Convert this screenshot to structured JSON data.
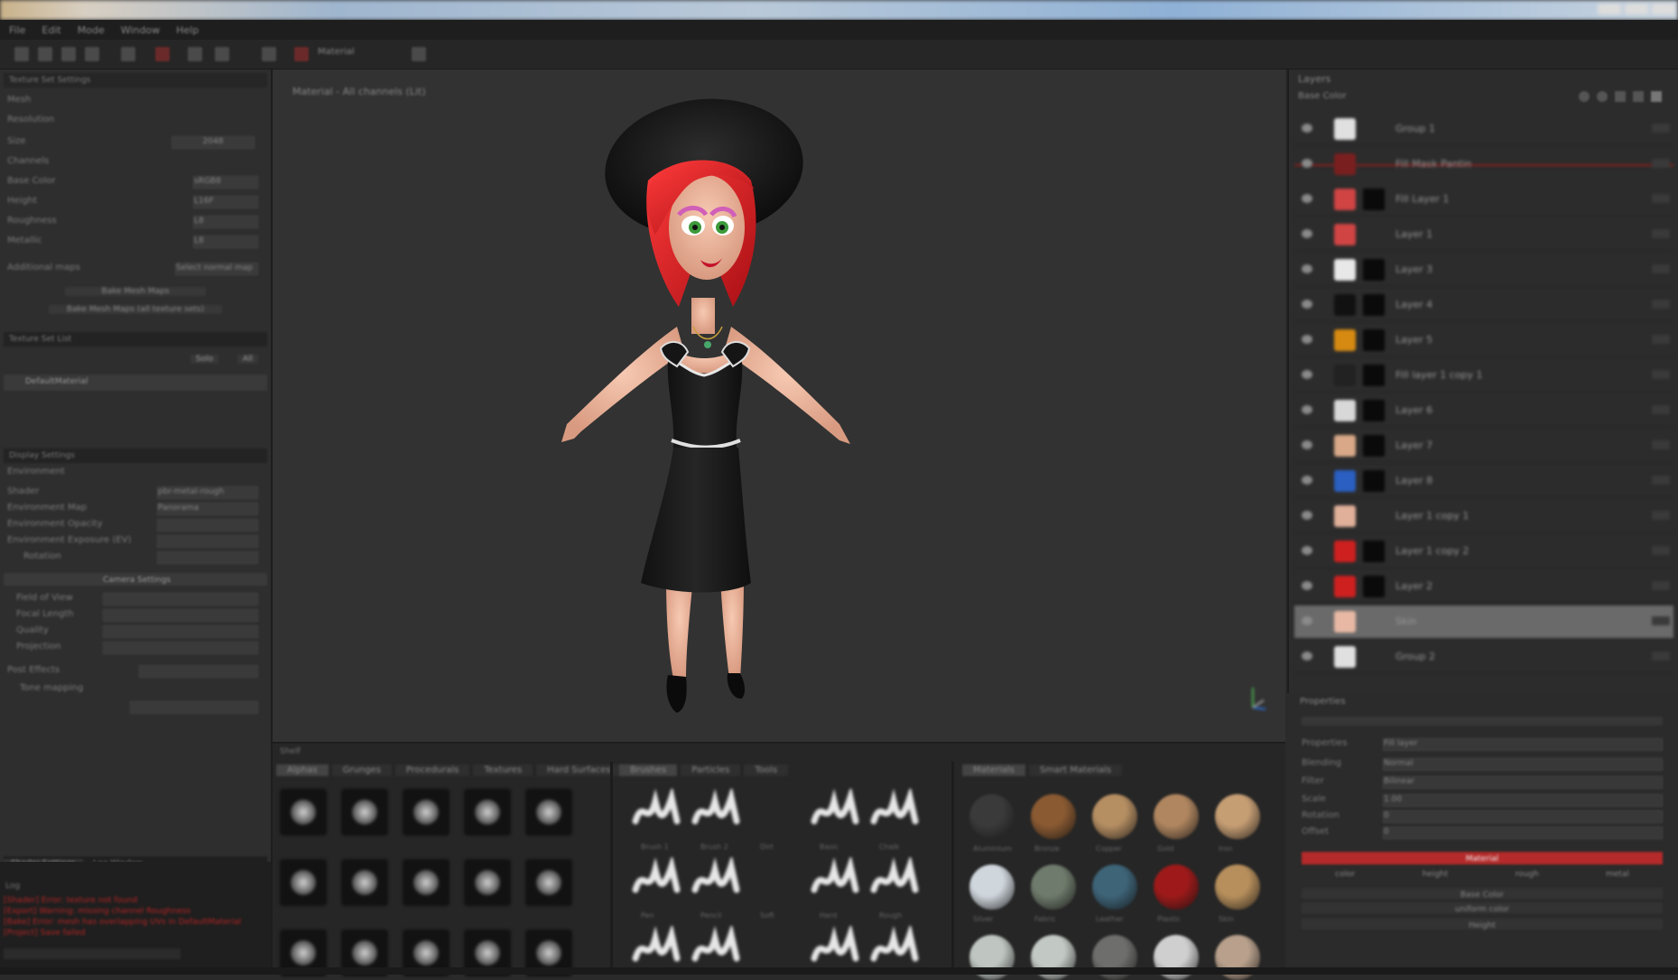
{
  "window": {
    "title": ""
  },
  "menubar": {
    "items": [
      "File",
      "Edit",
      "Mode",
      "Window",
      "Help"
    ]
  },
  "toolbar": {
    "dropdown_value": "Material"
  },
  "left_panel": {
    "section_texture_settings": "Texture Set Settings",
    "mesh_label": "Mesh",
    "resolution_label": "Resolution",
    "size_label": "Size",
    "size_value": "2048",
    "channels_label": "Channels",
    "channel_rows": [
      {
        "label": "Base Color",
        "value": "sRGB8"
      },
      {
        "label": "Height",
        "value": "L16F"
      },
      {
        "label": "Roughness",
        "value": "L8"
      },
      {
        "label": "Metallic",
        "value": "L8"
      }
    ],
    "additional_maps_label": "Additional maps",
    "select_normal_label": "Select normal map",
    "bake_button": "Bake Mesh Maps",
    "bake_all_button": "Bake Mesh Maps (all texture sets)",
    "section_texture_list": "Texture Set List",
    "solo_label": "Solo",
    "all_label": "All",
    "list_item": "DefaultMaterial",
    "section_display": "Display Settings",
    "env_label": "Environment",
    "display_rows": [
      {
        "label": "Shader",
        "value": "pbr-metal-rough"
      },
      {
        "label": "Environment Map",
        "value": "Panorama"
      },
      {
        "label": "Environment Opacity",
        "value": ""
      },
      {
        "label": "Environment Exposure (EV)",
        "value": ""
      },
      {
        "label": "Rotation",
        "value": ""
      }
    ],
    "camera_settings": "Camera Settings",
    "camera_rows": [
      {
        "label": "Field of View",
        "value": ""
      },
      {
        "label": "Focal Length",
        "value": ""
      },
      {
        "label": "Quality",
        "value": ""
      },
      {
        "label": "Projection",
        "value": ""
      }
    ],
    "post_label": "Post Effects",
    "tone_label": "Tone mapping",
    "log_tabs": [
      "Shader Settings",
      "Log Window"
    ],
    "log_title": "Log",
    "log_errors": [
      "[Shader] Error: texture not found",
      "[Export] Warning: missing channel Roughness",
      "[Bake] Error: mesh has overlapping UVs in DefaultMaterial",
      "[Project] Save failed"
    ]
  },
  "viewport": {
    "label": "Material - All channels (Lit)"
  },
  "layers": {
    "title": "Layers",
    "blend_label": "Base Color",
    "rows": [
      {
        "name": "Group 1",
        "thumb": "#e0e0e0",
        "mask": false
      },
      {
        "name": "Fill Mask Pantin",
        "thumb": "#7a1f1f",
        "mask": false
      },
      {
        "name": "Fill Layer 1",
        "thumb": "#d04444",
        "mask": true
      },
      {
        "name": "Layer 1",
        "thumb": "#d04444",
        "mask": false
      },
      {
        "name": "Layer 3",
        "thumb": "#e8e8e8",
        "mask": true
      },
      {
        "name": "Layer 4",
        "thumb": "#111111",
        "mask": true
      },
      {
        "name": "Layer 5",
        "thumb": "#d68a12",
        "mask": true
      },
      {
        "name": "Fill layer 1 copy 1",
        "thumb": "#222222",
        "mask": true
      },
      {
        "name": "Layer 6",
        "thumb": "#d8d8d8",
        "mask": true
      },
      {
        "name": "Layer 7",
        "thumb": "#d8a888",
        "mask": true
      },
      {
        "name": "Layer 8",
        "thumb": "#2b5fc2",
        "mask": true
      },
      {
        "name": "Layer 1 copy 1",
        "thumb": "#e0b09a",
        "mask": false
      },
      {
        "name": "Layer 1 copy 2",
        "thumb": "#cf2020",
        "mask": true
      },
      {
        "name": "Layer 2",
        "thumb": "#cf2020",
        "mask": true
      },
      {
        "name": "Skin",
        "thumb": "#e8b8a4",
        "mask": false
      },
      {
        "name": "Group 2",
        "thumb": "#e0e0e0",
        "mask": false
      }
    ]
  },
  "properties": {
    "title": "Properties",
    "rows": [
      {
        "label": "Properties",
        "value": "Fill layer"
      },
      {
        "label": "Blending",
        "value": "Normal"
      },
      {
        "label": "Filter",
        "value": "Bilinear"
      },
      {
        "label": "Scale",
        "value": "1.00"
      },
      {
        "label": "Rotation",
        "value": "0"
      },
      {
        "label": "Offset",
        "value": "0"
      }
    ],
    "material_button": "Material",
    "channel_buttons": [
      "color",
      "height",
      "rough",
      "metal"
    ],
    "base_color_label": "Base Color",
    "uniform_label": "uniform color",
    "height_label": "Height"
  },
  "shelf": {
    "title": "Shelf",
    "tabs_a": [
      "Alphas",
      "Grunges",
      "Procedurals",
      "Textures",
      "Hard Surfaces"
    ],
    "tabs_b": [
      "Brushes",
      "Particles",
      "Tools"
    ],
    "tabs_c": [
      "Materials",
      "Smart Materials"
    ],
    "spheres": [
      "#3a3a3a",
      "#8a5a32",
      "#b58e62",
      "#b08660",
      "#c69e74",
      "#cfd6dc",
      "#6f7b6c",
      "#3e6478",
      "#9e1a1a",
      "#b78f5c",
      "#bfc6c2",
      "#c2c8c4",
      "#6e6f6c",
      "#cfcfcf",
      "#b8a08c"
    ],
    "brush_labels": [
      "Brush 1",
      "Brush 2",
      "Dirt",
      "Basic",
      "Chalk",
      "Pen",
      "Pencil",
      "Soft",
      "Hard",
      "Rough"
    ],
    "sphere_labels": [
      "Aluminium",
      "Bronze",
      "Copper",
      "Gold",
      "Iron",
      "Silver",
      "Fabric",
      "Leather",
      "Plastic",
      "Skin"
    ]
  }
}
